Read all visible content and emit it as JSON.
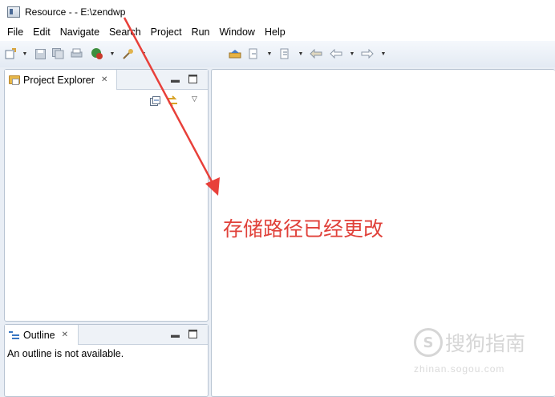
{
  "window": {
    "title": "Resource -  - E:\\zendwp"
  },
  "menu": [
    "File",
    "Edit",
    "Navigate",
    "Search",
    "Project",
    "Run",
    "Window",
    "Help"
  ],
  "project_explorer": {
    "tab_label": "Project Explorer",
    "close_glyph": "✕"
  },
  "outline": {
    "tab_label": "Outline",
    "close_glyph": "✕",
    "message": "An outline is not available."
  },
  "annotation": {
    "text": "存储路径已经更改",
    "color": "#e0413a"
  },
  "watermark": {
    "logo_glyph": "S",
    "brand": "搜狗指南",
    "url": "zhinan.sogou.com"
  },
  "colors": {
    "toolbar_bg": "#e3eaf3",
    "workbench_bg": "#e9eef5",
    "arrow": "#e8403a"
  }
}
